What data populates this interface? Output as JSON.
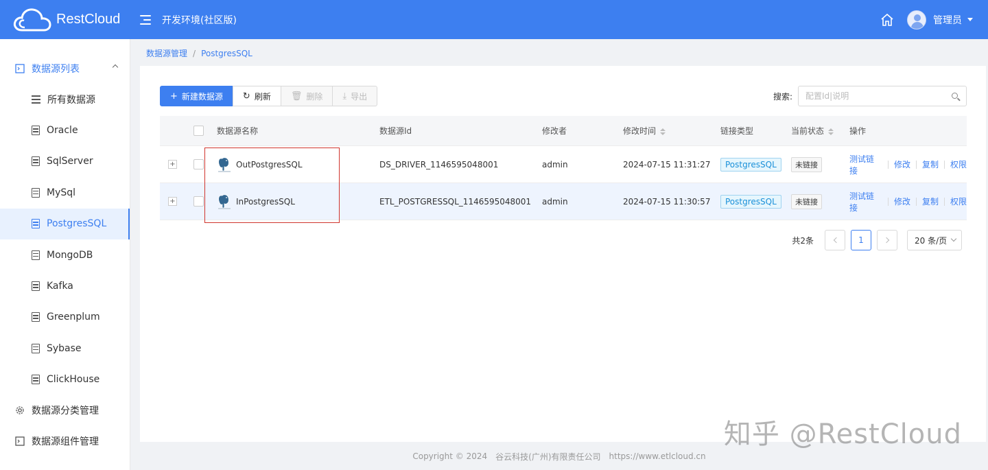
{
  "header": {
    "logo_text": "RestCloud",
    "env_title": "开发环境(社区版)",
    "user_name": "管理员"
  },
  "sidebar": {
    "group1": "数据源列表",
    "items": [
      {
        "label": "所有数据源"
      },
      {
        "label": "Oracle"
      },
      {
        "label": "SqlServer"
      },
      {
        "label": "MySql"
      },
      {
        "label": "PostgresSQL",
        "active": true
      },
      {
        "label": "MongoDB"
      },
      {
        "label": "Kafka"
      },
      {
        "label": "Greenplum"
      },
      {
        "label": "Sybase"
      },
      {
        "label": "ClickHouse"
      }
    ],
    "group2": "数据源分类管理",
    "group3": "数据源组件管理"
  },
  "breadcrumb": {
    "root": "数据源管理",
    "sep": "/",
    "current": "PostgresSQL"
  },
  "toolbar": {
    "new_label": "新建数据源",
    "refresh_label": "刷新",
    "delete_label": "删除",
    "export_label": "导出"
  },
  "search": {
    "label": "搜索:",
    "placeholder": "配置Id|说明"
  },
  "table": {
    "headers": {
      "name": "数据源名称",
      "id": "数据源Id",
      "modifier": "修改者",
      "time": "修改时间",
      "type": "链接类型",
      "state": "当前状态",
      "ops": "操作"
    },
    "rows": [
      {
        "expand": "+",
        "name": "OutPostgresSQL",
        "id": "DS_DRIVER_1146595048001",
        "modifier": "admin",
        "time": "2024-07-15 11:31:27",
        "type": "PostgresSQL",
        "state": "未链接",
        "ops": [
          "测试链接",
          "修改",
          "复制",
          "权限"
        ]
      },
      {
        "expand": "+",
        "name": "InPostgresSQL",
        "id": "ETL_POSTGRESSQL_1146595048001",
        "modifier": "admin",
        "time": "2024-07-15 11:30:57",
        "type": "PostgresSQL",
        "state": "未链接",
        "ops": [
          "测试链接",
          "修改",
          "复制",
          "权限"
        ]
      }
    ]
  },
  "pagination": {
    "total": "共2条",
    "current": "1",
    "size": "20 条/页"
  },
  "footer": {
    "copyright": "Copyright © 2024",
    "company": "谷云科技(广州)有限责任公司",
    "url": "https://www.etlcloud.cn"
  },
  "watermark": "知乎 @RestCloud",
  "colors": {
    "primary": "#3d7ff0",
    "highlight_border": "#d0342c",
    "tag_type": "#1a90d9"
  }
}
